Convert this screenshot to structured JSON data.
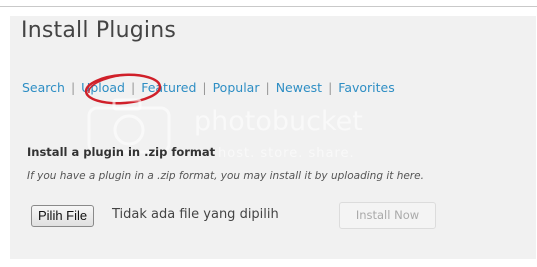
{
  "page": {
    "title": "Install Plugins"
  },
  "subnav": {
    "items": [
      {
        "label": "Search"
      },
      {
        "label": "Upload"
      },
      {
        "label": "Featured"
      },
      {
        "label": "Popular"
      },
      {
        "label": "Newest"
      },
      {
        "label": "Favorites"
      }
    ],
    "separator": "|",
    "current": "Upload"
  },
  "upload": {
    "heading": "Install a plugin in .zip format",
    "help": "If you have a plugin in a .zip format, you may install it by uploading it here.",
    "file_button_label": "Pilih File",
    "file_status": "Tidak ada file yang dipilih",
    "install_button_label": "Install Now",
    "install_button_enabled": false
  },
  "watermark": {
    "brand": "photobucket",
    "tagline": "host. store. share."
  },
  "colors": {
    "link": "#2e8ec4",
    "panel_bg": "#f1f1f1",
    "annotation": "#d0202a"
  }
}
